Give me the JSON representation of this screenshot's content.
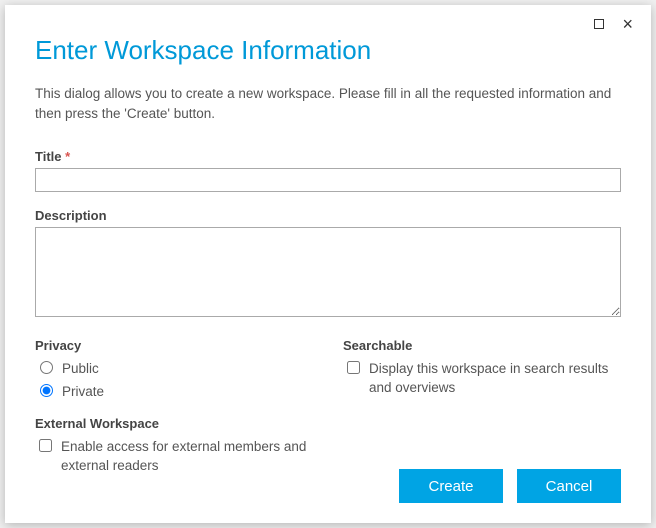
{
  "dialog": {
    "title": "Enter Workspace Information",
    "subtitle": "This dialog allows you to create a new workspace. Please fill in all the requested information and then press the 'Create' button."
  },
  "fields": {
    "title_label": "Title",
    "title_value": "",
    "description_label": "Description",
    "description_value": ""
  },
  "privacy": {
    "heading": "Privacy",
    "options": {
      "public": "Public",
      "private": "Private"
    },
    "selected": "private"
  },
  "searchable": {
    "heading": "Searchable",
    "label": "Display this workspace in search results and overviews",
    "checked": false
  },
  "external": {
    "heading": "External Workspace",
    "label": "Enable access for external members and external readers",
    "checked": false
  },
  "buttons": {
    "create": "Create",
    "cancel": "Cancel"
  },
  "required_mark": "*"
}
